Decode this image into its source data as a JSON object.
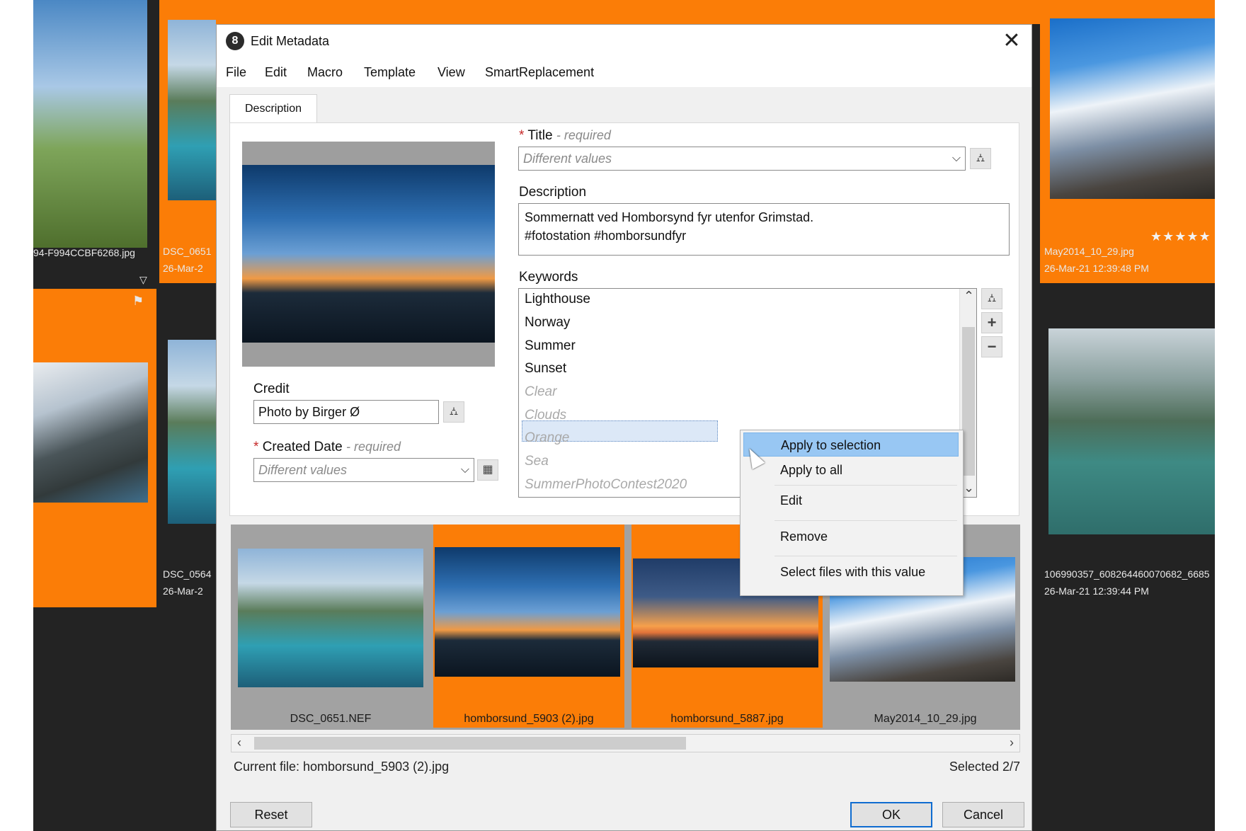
{
  "background": {
    "captions": [
      {
        "name": "94-F994CCBF6268.jpg"
      },
      {
        "name": "DSC_0651",
        "date": "26-Mar-2"
      },
      {
        "name": "May2014_10_29.jpg",
        "date": "26-Mar-21 12:39:48 PM",
        "stars": "★★★★★"
      },
      {
        "name": "DSC_0564",
        "date": "26-Mar-2"
      },
      {
        "name": "106990357_608264460070682_6685",
        "date": "26-Mar-21 12:39:44 PM"
      }
    ]
  },
  "dialog": {
    "title": "Edit Metadata",
    "app_icon_glyph": "8",
    "close_glyph": "✕",
    "menu": [
      "File",
      "Edit",
      "Macro",
      "Template",
      "View",
      "SmartReplacement"
    ],
    "tab": "Description",
    "required_mark": "*",
    "title_field": {
      "label": "Title",
      "hint": "- required",
      "value": "Different values"
    },
    "description_field": {
      "label": "Description",
      "line1": "Sommernatt ved Homborsynd fyr utenfor Grimstad.",
      "line2": "#fotostation #homborsundfyr"
    },
    "keywords_field": {
      "label": "Keywords",
      "items": [
        "Lighthouse",
        "Norway",
        "Summer",
        "Sunset",
        "Clear",
        "Clouds",
        "Orange",
        "Sea",
        "SummerPhotoContest2020"
      ]
    },
    "credit_field": {
      "label": "Credit",
      "value": "Photo by Birger Ø"
    },
    "created_date_field": {
      "label": "Created Date",
      "hint": "- required",
      "value": "Different values"
    },
    "context_menu": [
      "Apply to selection",
      "Apply to all",
      "Edit",
      "Remove",
      "Select files with this value"
    ],
    "thumbnails": [
      {
        "caption": "DSC_0651.NEF",
        "selected": false
      },
      {
        "caption": "homborsund_5903 (2).jpg",
        "selected": true
      },
      {
        "caption": "homborsund_5887.jpg",
        "selected": true
      },
      {
        "caption": "May2014_10_29.jpg",
        "selected": false
      }
    ],
    "status": {
      "current_file": "Current file: homborsund_5903 (2).jpg",
      "selected": "Selected 2/7"
    },
    "buttons": {
      "reset": "Reset",
      "ok": "OK",
      "cancel": "Cancel"
    },
    "icons": {
      "hierarchy": "⛼",
      "plus": "+",
      "minus": "−",
      "calendar": "▦",
      "dropdown": "⌵",
      "scroll_up": "⌃",
      "scroll_down": "⌄",
      "scroll_left": "‹",
      "scroll_right": "›"
    }
  }
}
